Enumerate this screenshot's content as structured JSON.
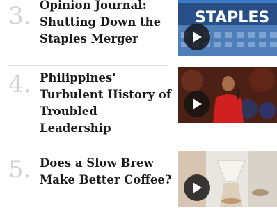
{
  "articles": [
    {
      "number": "3.",
      "title": "Opinion Journal: Shutting Down the Staples Merger",
      "thumb_text": "STAPLES",
      "icon": "play-icon"
    },
    {
      "number": "4.",
      "title": "Philippines' Turbulent History of Troubled Leadership",
      "icon": "play-icon"
    },
    {
      "number": "5.",
      "title": "Does a Slow Brew Make Better Coffee?",
      "icon": "play-icon"
    }
  ]
}
